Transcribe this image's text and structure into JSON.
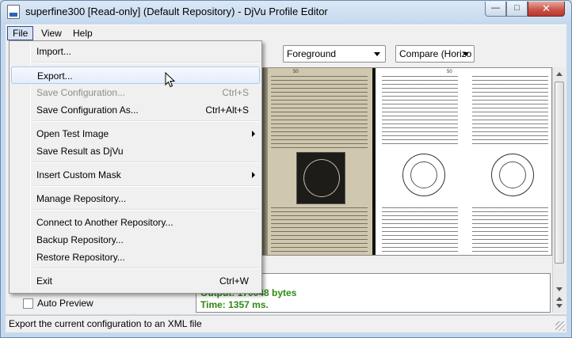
{
  "window": {
    "title": "superfine300 [Read-only] (Default Repository) - DjVu Profile Editor",
    "minimize_glyph": "—",
    "maximize_glyph": "□",
    "close_glyph": "✕",
    "icon": "djvu-app-icon"
  },
  "menubar": {
    "items": [
      {
        "label": "File",
        "active": true
      },
      {
        "label": "View"
      },
      {
        "label": "Help"
      }
    ]
  },
  "file_menu": {
    "items": [
      {
        "label": "Import...",
        "shortcut": "",
        "enabled": true
      },
      {
        "label": "Export...",
        "shortcut": "",
        "enabled": true,
        "highlighted": true
      },
      {
        "label": "Save Configuration...",
        "shortcut": "Ctrl+S",
        "enabled": false
      },
      {
        "label": "Save Configuration As...",
        "shortcut": "Ctrl+Alt+S",
        "enabled": true
      },
      {
        "label": "Open Test Image",
        "shortcut": "",
        "enabled": true,
        "submenu": true
      },
      {
        "label": "Save Result as DjVu",
        "shortcut": "",
        "enabled": true
      },
      {
        "label": "Insert Custom Mask",
        "shortcut": "",
        "enabled": true,
        "submenu": true
      },
      {
        "label": "Manage Repository...",
        "shortcut": "",
        "enabled": true
      },
      {
        "label": "Connect to Another Repository...",
        "shortcut": "",
        "enabled": true
      },
      {
        "label": "Backup Repository...",
        "shortcut": "",
        "enabled": true
      },
      {
        "label": "Restore Repository...",
        "shortcut": "",
        "enabled": true
      },
      {
        "label": "Exit",
        "shortcut": "Ctrl+W",
        "enabled": true
      }
    ]
  },
  "toolbar": {
    "layer_select": "Foreground",
    "compare_select": "Compare (Horizo"
  },
  "preview": {
    "page_number_left": "50",
    "page_number_right": "50"
  },
  "output": {
    "line1": "cess.",
    "line2": "Output: 170048 bytes",
    "line3": "Time: 1357 ms.",
    "color": "#2d8a12"
  },
  "auto_preview": {
    "label": "Auto Preview",
    "checked": false
  },
  "statusbar": {
    "text": "Export the current configuration to an XML file"
  },
  "colors": {
    "titlebar": "#c5d9ee",
    "menu_highlight": "#d6e3f4",
    "close_button": "#c75049"
  }
}
